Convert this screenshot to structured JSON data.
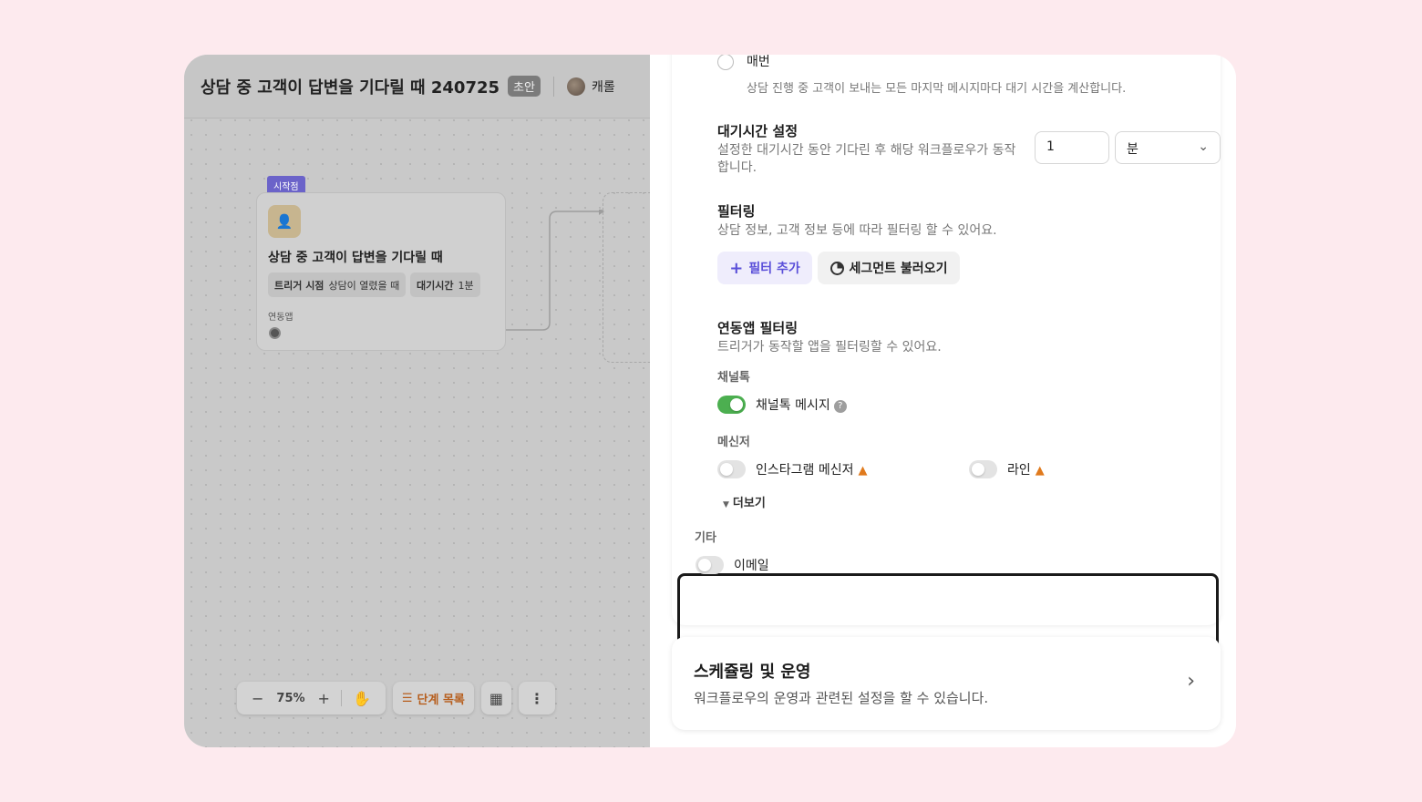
{
  "header": {
    "workflow_title": "상담 중 고객이 답변을 기다릴 때 240725",
    "status_badge": "초안",
    "author": "캐롤"
  },
  "canvas": {
    "start_tag": "시작점",
    "node": {
      "title": "상담 중 고객이 답변을 기다릴 때",
      "chips": [
        {
          "label": "트리거 시점",
          "value": "상담이 열렸을 때"
        },
        {
          "label": "대기시간",
          "value": "1분"
        }
      ],
      "apps_label": "연동앱"
    },
    "toolbar": {
      "zoom_out": "−",
      "zoom_level": "75%",
      "zoom_in": "+",
      "hand": "✋",
      "steps_label": "단계 목록",
      "grid": "▦",
      "more": "⋮"
    }
  },
  "panel": {
    "radio_every": {
      "label": "매번",
      "description": "상담 진행 중 고객이 보내는 모든 마지막 메시지마다 대기 시간을 계산합니다.",
      "checked": false
    },
    "wait_time": {
      "title": "대기시간 설정",
      "description": "설정한 대기시간 동안 기다린 후 해당 워크플로우가 동작합니다.",
      "value": "1",
      "unit": "분"
    },
    "filtering": {
      "title": "필터링",
      "description": "상담 정보, 고객 정보 등에 따라 필터링 할 수 있어요.",
      "add_filter": "필터 추가",
      "load_segment": "세그먼트 불러오기"
    },
    "app_filtering": {
      "title": "연동앱 필터링",
      "description": "트리거가 동작할 앱을 필터링할 수 있어요.",
      "groups": {
        "channeltalk": {
          "label": "채널톡",
          "items": [
            {
              "label": "채널톡 메시지",
              "on": true
            }
          ]
        },
        "messenger": {
          "label": "메신저",
          "items": [
            {
              "label": "인스타그램 메신저",
              "on": false
            },
            {
              "label": "라인",
              "on": false
            }
          ]
        },
        "more_label": "더보기",
        "other": {
          "label": "기타",
          "items": [
            {
              "label": "이메일",
              "on": false
            }
          ]
        }
      }
    },
    "scheduling": {
      "title": "스케쥴링 및 운영",
      "description": "워크플로우의 운영과 관련된 설정을 할 수 있습니다."
    }
  },
  "colors": {
    "background": "#fdeaee",
    "accent_purple": "#5a4fd9",
    "toggle_on": "#4caf50",
    "warning": "#e07a1d",
    "steps_orange": "#b65d1c"
  }
}
